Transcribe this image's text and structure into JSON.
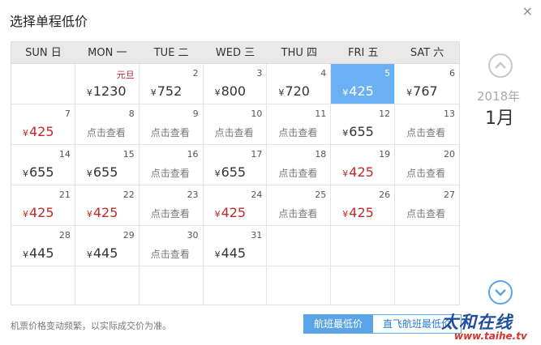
{
  "dialog": {
    "title": "选择单程低价",
    "close_glyph": "×",
    "note": "机票价格变动频繁，以实际成交价为准。"
  },
  "weekdays": [
    "SUN 日",
    "MON 一",
    "TUE 二",
    "WED 三",
    "THU 四",
    "FRI 五",
    "SAT 六"
  ],
  "currency_symbol": "¥",
  "cells": [
    {
      "day": "",
      "label": "",
      "price": "",
      "check": "",
      "low": false,
      "selected": false
    },
    {
      "day": "",
      "label": "元旦",
      "price": "1230",
      "check": "",
      "low": false,
      "selected": false
    },
    {
      "day": "2",
      "label": "",
      "price": "752",
      "check": "",
      "low": false,
      "selected": false
    },
    {
      "day": "3",
      "label": "",
      "price": "800",
      "check": "",
      "low": false,
      "selected": false
    },
    {
      "day": "4",
      "label": "",
      "price": "720",
      "check": "",
      "low": false,
      "selected": false
    },
    {
      "day": "5",
      "label": "",
      "price": "425",
      "check": "",
      "low": false,
      "selected": true
    },
    {
      "day": "6",
      "label": "",
      "price": "767",
      "check": "",
      "low": false,
      "selected": false
    },
    {
      "day": "7",
      "label": "",
      "price": "425",
      "check": "",
      "low": true,
      "selected": false
    },
    {
      "day": "8",
      "label": "",
      "price": "",
      "check": "点击查看",
      "low": false,
      "selected": false
    },
    {
      "day": "9",
      "label": "",
      "price": "",
      "check": "点击查看",
      "low": false,
      "selected": false
    },
    {
      "day": "10",
      "label": "",
      "price": "",
      "check": "点击查看",
      "low": false,
      "selected": false
    },
    {
      "day": "11",
      "label": "",
      "price": "",
      "check": "点击查看",
      "low": false,
      "selected": false
    },
    {
      "day": "12",
      "label": "",
      "price": "655",
      "check": "",
      "low": false,
      "selected": false
    },
    {
      "day": "13",
      "label": "",
      "price": "",
      "check": "点击查看",
      "low": false,
      "selected": false
    },
    {
      "day": "14",
      "label": "",
      "price": "655",
      "check": "",
      "low": false,
      "selected": false
    },
    {
      "day": "15",
      "label": "",
      "price": "655",
      "check": "",
      "low": false,
      "selected": false
    },
    {
      "day": "16",
      "label": "",
      "price": "",
      "check": "点击查看",
      "low": false,
      "selected": false
    },
    {
      "day": "17",
      "label": "",
      "price": "655",
      "check": "",
      "low": false,
      "selected": false
    },
    {
      "day": "18",
      "label": "",
      "price": "",
      "check": "点击查看",
      "low": false,
      "selected": false
    },
    {
      "day": "19",
      "label": "",
      "price": "425",
      "check": "",
      "low": true,
      "selected": false
    },
    {
      "day": "20",
      "label": "",
      "price": "",
      "check": "点击查看",
      "low": false,
      "selected": false
    },
    {
      "day": "21",
      "label": "",
      "price": "425",
      "check": "",
      "low": true,
      "selected": false
    },
    {
      "day": "22",
      "label": "",
      "price": "425",
      "check": "",
      "low": true,
      "selected": false
    },
    {
      "day": "23",
      "label": "",
      "price": "",
      "check": "点击查看",
      "low": false,
      "selected": false
    },
    {
      "day": "24",
      "label": "",
      "price": "425",
      "check": "",
      "low": true,
      "selected": false
    },
    {
      "day": "25",
      "label": "",
      "price": "",
      "check": "点击查看",
      "low": false,
      "selected": false
    },
    {
      "day": "26",
      "label": "",
      "price": "425",
      "check": "",
      "low": true,
      "selected": false
    },
    {
      "day": "27",
      "label": "",
      "price": "",
      "check": "点击查看",
      "low": false,
      "selected": false
    },
    {
      "day": "28",
      "label": "",
      "price": "445",
      "check": "",
      "low": false,
      "selected": false
    },
    {
      "day": "29",
      "label": "",
      "price": "445",
      "check": "",
      "low": false,
      "selected": false
    },
    {
      "day": "30",
      "label": "",
      "price": "",
      "check": "点击查看",
      "low": false,
      "selected": false
    },
    {
      "day": "31",
      "label": "",
      "price": "445",
      "check": "",
      "low": false,
      "selected": false
    },
    {
      "day": "",
      "label": "",
      "price": "",
      "check": "",
      "low": false,
      "selected": false
    },
    {
      "day": "",
      "label": "",
      "price": "",
      "check": "",
      "low": false,
      "selected": false
    },
    {
      "day": "",
      "label": "",
      "price": "",
      "check": "",
      "low": false,
      "selected": false
    },
    {
      "day": "",
      "label": "",
      "price": "",
      "check": "",
      "low": false,
      "selected": false
    },
    {
      "day": "",
      "label": "",
      "price": "",
      "check": "",
      "low": false,
      "selected": false
    },
    {
      "day": "",
      "label": "",
      "price": "",
      "check": "",
      "low": false,
      "selected": false
    },
    {
      "day": "",
      "label": "",
      "price": "",
      "check": "",
      "low": false,
      "selected": false
    },
    {
      "day": "",
      "label": "",
      "price": "",
      "check": "",
      "low": false,
      "selected": false
    },
    {
      "day": "",
      "label": "",
      "price": "",
      "check": "",
      "low": false,
      "selected": false
    },
    {
      "day": "",
      "label": "",
      "price": "",
      "check": "",
      "low": false,
      "selected": false
    }
  ],
  "side": {
    "year": "2018年",
    "month": "1月",
    "prev_icon": "chevron-up-icon",
    "next_icon": "chevron-down-icon"
  },
  "footer": {
    "btn_lowest": "航班最低价",
    "btn_direct": "直飞航班最低价"
  },
  "watermark": {
    "cn": "太和在线",
    "en": "www.taihe.tv"
  },
  "colors": {
    "selected_bg": "#6ab0f3",
    "low_price": "#c0292a",
    "accent": "#5aa5e6"
  }
}
